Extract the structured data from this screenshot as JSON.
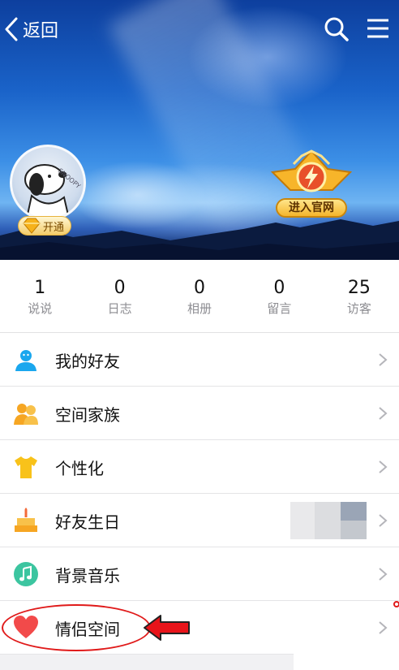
{
  "nav": {
    "back_label": "返回",
    "icons": [
      "chevron-left-icon",
      "search-icon",
      "menu-icon"
    ]
  },
  "profile": {
    "vip_label": "开通",
    "official_label": "进入官网"
  },
  "stats": [
    {
      "value": "1",
      "label": "说说"
    },
    {
      "value": "0",
      "label": "日志"
    },
    {
      "value": "0",
      "label": "相册"
    },
    {
      "value": "0",
      "label": "留言"
    },
    {
      "value": "25",
      "label": "访客"
    }
  ],
  "menu": [
    {
      "label": "我的好友",
      "icon": "person-icon",
      "color": "#1aa7ee"
    },
    {
      "label": "空间家族",
      "icon": "family-icon",
      "color": "#f6a623"
    },
    {
      "label": "个性化",
      "icon": "tshirt-icon",
      "color": "#f8c21a"
    },
    {
      "label": "好友生日",
      "icon": "cake-icon",
      "color": "#f6a623"
    },
    {
      "label": "背景音乐",
      "icon": "music-icon",
      "color": "#3cc5a0"
    },
    {
      "label": "情侣空间",
      "icon": "heart-icon",
      "color": "#f24a4a"
    }
  ],
  "colors": {
    "annotation": "#e01a1a",
    "sky": "#1a63c9"
  }
}
